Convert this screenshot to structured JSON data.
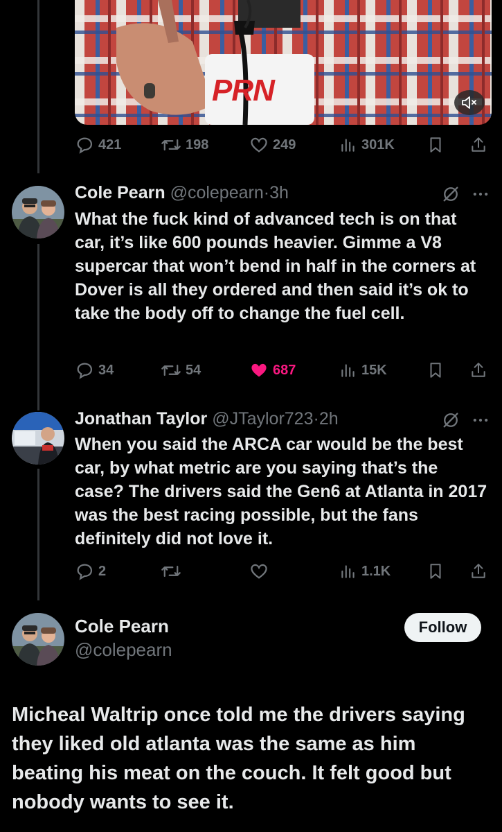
{
  "media": {
    "mic_logo_text": "PRN",
    "mute_icon": "speaker-mute-icon"
  },
  "top_stats": {
    "replies": "421",
    "reposts": "198",
    "likes": "249",
    "views": "301K"
  },
  "tweets": [
    {
      "name": "Cole Pearn",
      "handle": "@colepearn",
      "dot": "·",
      "time": "3h",
      "text": "What the fuck kind of advanced tech is on that car, it’s like 600 pounds heavier. Gimme a V8 supercar that won’t bend in half in the corners at Dover is all they ordered and then said it’s ok to take the body off to change the fuel cell.",
      "stats": {
        "replies": "34",
        "reposts": "54",
        "likes": "687",
        "views": "15K"
      },
      "liked": true
    },
    {
      "name": "Jonathan Taylor",
      "handle": "@JTaylor723",
      "dot": "·",
      "time": "2h",
      "text": "When you said the ARCA car would be the best car, by what metric are you saying that’s the case? The drivers said the Gen6 at Atlanta in 2017 was the best racing possible, but the fans definitely did not love it.",
      "stats": {
        "replies": "2",
        "reposts": "",
        "likes": "",
        "views": "1.1K"
      },
      "liked": false
    }
  ],
  "main_tweet": {
    "name": "Cole Pearn",
    "handle": "@colepearn",
    "follow_label": "Follow",
    "text": "Micheal Waltrip once told me the drivers saying they liked old atlanta was the same as him beating his meat on the couch. It felt good but nobody wants to see it."
  },
  "colors": {
    "like": "#f91880",
    "muted": "#71767b",
    "text": "#e7e9ea"
  }
}
